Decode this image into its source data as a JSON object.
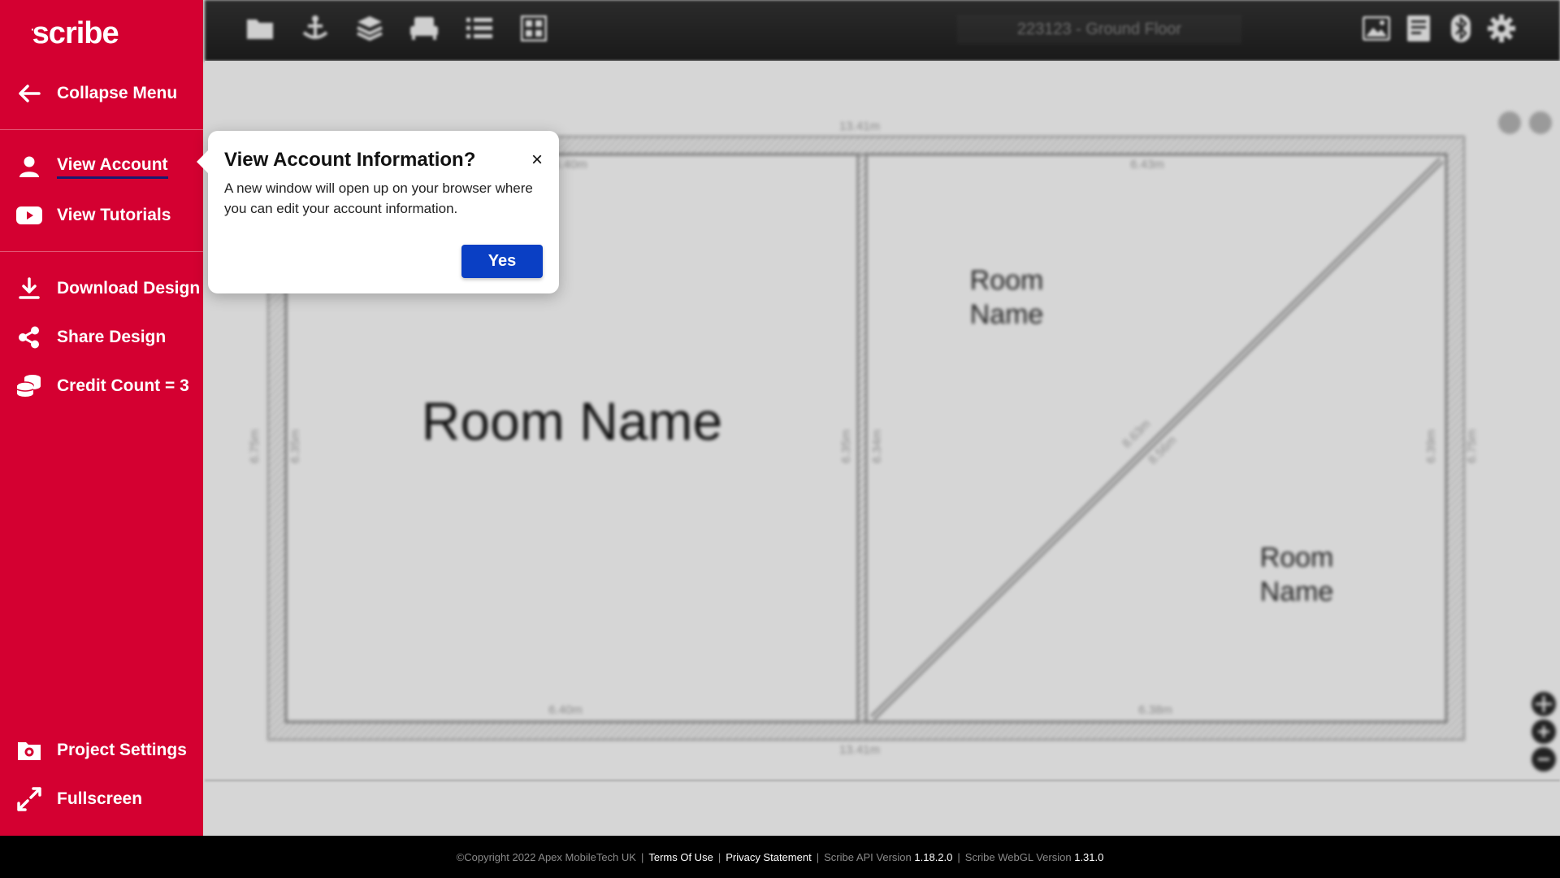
{
  "app": {
    "logo": "scribe"
  },
  "sidebar": {
    "items": [
      {
        "id": "collapse",
        "label": "Collapse Menu",
        "icon": "arrow-left-icon"
      },
      {
        "id": "account",
        "label": "View Account",
        "icon": "user-icon",
        "active": true
      },
      {
        "id": "tutorials",
        "label": "View Tutorials",
        "icon": "youtube-icon"
      },
      {
        "id": "download",
        "label": "Download Design",
        "icon": "download-icon"
      },
      {
        "id": "share",
        "label": "Share Design",
        "icon": "share-icon"
      },
      {
        "id": "credit",
        "label": "Credit Count = 3",
        "icon": "coins-icon"
      },
      {
        "id": "settings",
        "label": "Project Settings",
        "icon": "folder-gear-icon"
      },
      {
        "id": "fullscreen",
        "label": "Fullscreen",
        "icon": "expand-icon"
      }
    ]
  },
  "toolbar": {
    "title": "223123 - Ground Floor",
    "left_icons": [
      "folder-icon",
      "anchor-icon",
      "layers-icon",
      "sofa-icon",
      "list-icon",
      "grid-icon"
    ],
    "right_icons": [
      "image-icon",
      "document-icon",
      "bluetooth-icon",
      "gear-icon"
    ]
  },
  "canvas": {
    "rooms": [
      {
        "name": "Room Name"
      },
      {
        "name_line1": "Room",
        "name_line2": "Name"
      },
      {
        "name_line1": "Room",
        "name_line2": "Name"
      }
    ],
    "dimensions": {
      "top_outer": "13.41m",
      "bottom_outer": "13.41m",
      "left_top_inner": "6.40m",
      "right_top_inner": "6.43m",
      "left_bottom_inner": "6.40m",
      "right_bottom_inner": "6.38m",
      "left_outer": "6.75m",
      "left_inner": "6.35m",
      "mid_left": "6.35m",
      "mid_right": "6.34m",
      "right_inner": "6.39m",
      "right_outer": "6.75m",
      "diag_a": "8.63m",
      "diag_b": "8.56m"
    }
  },
  "popover": {
    "title": "View Account Information?",
    "body": "A new window will open up on your browser where you can edit your account information.",
    "confirm": "Yes",
    "close": "×"
  },
  "footer": {
    "copyright": "©Copyright 2022 Apex MobileTech UK",
    "terms": "Terms Of Use",
    "privacy": "Privacy Statement",
    "api_label": "Scribe API Version",
    "api_version": "1.18.2.0",
    "webgl_label": "Scribe WebGL Version",
    "webgl_version": "1.31.0",
    "separator": "|"
  },
  "colors": {
    "sidebar": "#d40031",
    "primary_button": "#0a3fc4",
    "footer": "#000000"
  }
}
